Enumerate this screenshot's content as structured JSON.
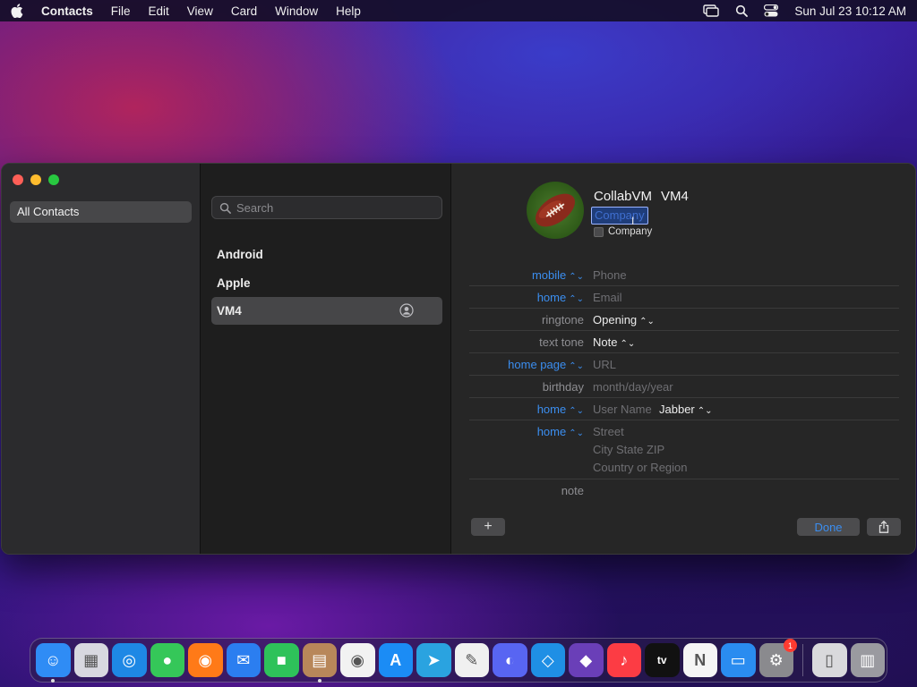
{
  "menubar": {
    "app_name": "Contacts",
    "items": [
      "File",
      "Edit",
      "View",
      "Card",
      "Window",
      "Help"
    ],
    "clock": "Sun Jul 23  10:12 AM"
  },
  "sidebar": {
    "groups": [
      {
        "label": "All Contacts",
        "selected": true
      }
    ]
  },
  "contact_list": {
    "search_placeholder": "Search",
    "contacts": [
      {
        "name": "Android",
        "selected": false
      },
      {
        "name": "Apple",
        "selected": false
      },
      {
        "name": "VM4",
        "selected": true
      }
    ]
  },
  "card": {
    "first_name": "CollabVM",
    "last_name": "VM4",
    "company_field_placeholder": "Company",
    "company_checkbox_label": "Company",
    "fields": [
      {
        "label": "mobile",
        "label_style": "blue",
        "has_chevron": true,
        "value": "Phone",
        "value_style": "placeholder"
      },
      {
        "label": "home",
        "label_style": "blue",
        "has_chevron": true,
        "value": "Email",
        "value_style": "placeholder"
      },
      {
        "label": "ringtone",
        "label_style": "gray",
        "has_chevron": false,
        "value": "Opening",
        "value_style": "strong",
        "value_chevron": true
      },
      {
        "label": "text tone",
        "label_style": "gray",
        "has_chevron": false,
        "value": "Note",
        "value_style": "strong",
        "value_chevron": true
      },
      {
        "label": "home page",
        "label_style": "blue",
        "has_chevron": true,
        "value": "URL",
        "value_style": "placeholder"
      },
      {
        "label": "birthday",
        "label_style": "gray",
        "has_chevron": false,
        "value": "month/day/year",
        "value_style": "placeholder"
      },
      {
        "label": "home",
        "label_style": "blue",
        "has_chevron": true,
        "value": "User Name",
        "value_style": "placeholder",
        "extra": "Jabber"
      },
      {
        "label": "home",
        "label_style": "blue",
        "has_chevron": true,
        "address": [
          "Street",
          "City  State  ZIP",
          "Country or Region"
        ]
      },
      {
        "label": "note",
        "label_style": "gray",
        "has_chevron": false,
        "value": "",
        "value_style": "placeholder"
      }
    ],
    "add_button": "+",
    "done_button": "Done"
  },
  "dock": {
    "apps": [
      {
        "name": "Finder",
        "icon": "finder-icon",
        "color": "#2f8cf5",
        "running": true
      },
      {
        "name": "Launchpad",
        "icon": "launchpad-icon",
        "color": "#d8d8e0"
      },
      {
        "name": "Safari",
        "icon": "safari-icon",
        "color": "#1e88e5"
      },
      {
        "name": "Messages",
        "icon": "messages-icon",
        "color": "#35c759"
      },
      {
        "name": "Firefox",
        "icon": "firefox-icon",
        "color": "#ff7a18"
      },
      {
        "name": "Mail",
        "icon": "mail-icon",
        "color": "#2b7ef0"
      },
      {
        "name": "FaceTime",
        "icon": "facetime-icon",
        "color": "#2ec25a"
      },
      {
        "name": "Contacts",
        "icon": "contacts-icon",
        "color": "#b8875a",
        "running": true
      },
      {
        "name": "Chrome",
        "icon": "chrome-icon",
        "color": "#f2f2f2"
      },
      {
        "name": "App Store",
        "icon": "app-store-icon",
        "color": "#1b8cf5"
      },
      {
        "name": "Telegram",
        "icon": "telegram-icon",
        "color": "#2aa3e0"
      },
      {
        "name": "TextEdit",
        "icon": "textedit-icon",
        "color": "#f0f0f0"
      },
      {
        "name": "Discord",
        "icon": "discord-icon",
        "color": "#5865f2"
      },
      {
        "name": "VS Code",
        "icon": "vscode-icon",
        "color": "#1f8fe5"
      },
      {
        "name": "Visual Studio",
        "icon": "visual-studio-icon",
        "color": "#6a3fb8"
      },
      {
        "name": "Music",
        "icon": "music-icon",
        "color": "#fc3c44"
      },
      {
        "name": "Apple TV",
        "icon": "apple-tv-icon",
        "color": "#111111"
      },
      {
        "name": "News",
        "icon": "news-icon",
        "color": "#f5f5f5"
      },
      {
        "name": "Keynote",
        "icon": "keynote-icon",
        "color": "#2a8cf0"
      },
      {
        "name": "System Settings",
        "icon": "system-settings-icon",
        "color": "#8a8a8e",
        "badge": "1"
      }
    ],
    "others": [
      {
        "name": "Downloads",
        "icon": "downloads-icon",
        "color": "#d9d9dc"
      },
      {
        "name": "Trash",
        "icon": "trash-icon",
        "color": "#9a9aa0"
      }
    ]
  }
}
